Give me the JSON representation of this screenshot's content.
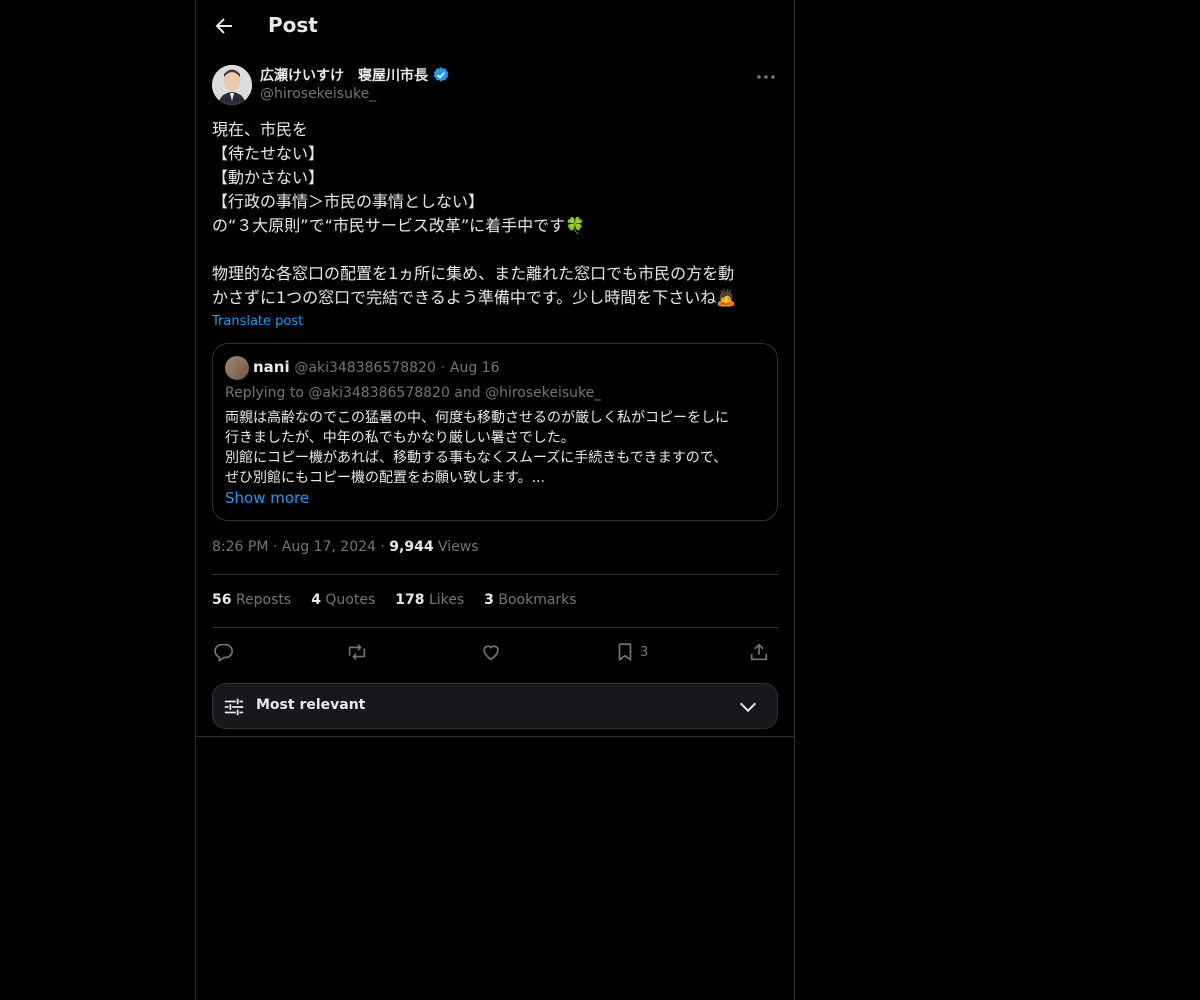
{
  "header": {
    "title": "Post"
  },
  "post": {
    "author_name": "広瀬けいすけ　寝屋川市長",
    "author_handle": "@hirosekeisuke_",
    "lines": [
      "現在、市民を",
      "【待たせない】",
      "【動かさない】",
      "【行政の事情＞市民の事情としない】",
      "の“３大原則”で“市民サービス改革”に着手中です🍀",
      "",
      "物理的な各窓口の配置を1ヵ所に集め、また離れた窓口でも市民の方を動",
      "かさずに1つの窓口で完結できるよう準備中です。少し時間を下さいね🙇"
    ],
    "translate_label": "Translate post"
  },
  "quote": {
    "name": "nani",
    "handle": "@aki348386578820",
    "separator": "·",
    "date": "Aug 16",
    "replying_prefix": "Replying to",
    "replying_to": "@aki348386578820 and @hirosekeisuke_",
    "lines": [
      "両親は高齢なのでこの猛暑の中、何度も移動させるのが厳しく私がコピーをしに",
      "行きましたが、中年の私でもかなり厳しい暑さでした。",
      "別館にコピー機があれば、移動する事もなくスムーズに手続きもできますので、",
      "ぜひ別館にもコピー機の配置をお願い致します。..."
    ],
    "show_more": "Show more"
  },
  "meta": {
    "time": "8:26 PM",
    "sep1": "·",
    "date": "Aug 17, 2024",
    "sep2": "·",
    "views_count": "9,944",
    "views_label": "Views"
  },
  "stats": {
    "reposts_count": "56",
    "reposts_label": "Reposts",
    "quotes_count": "4",
    "quotes_label": "Quotes",
    "likes_count": "178",
    "likes_label": "Likes",
    "bookmarks_count": "3",
    "bookmarks_label": "Bookmarks"
  },
  "actions": {
    "icons": [
      "reply-icon",
      "repost-icon",
      "like-icon",
      "bookmark-icon",
      "share-icon"
    ],
    "bookmark_count": "3"
  },
  "sort": {
    "label": "Most relevant",
    "icon": "sliders-icon"
  },
  "colors": {
    "background": "#000000",
    "accent": "#1d9bf0",
    "muted": "#71767b",
    "border": "#2f3336",
    "text": "#e7e9ea"
  }
}
